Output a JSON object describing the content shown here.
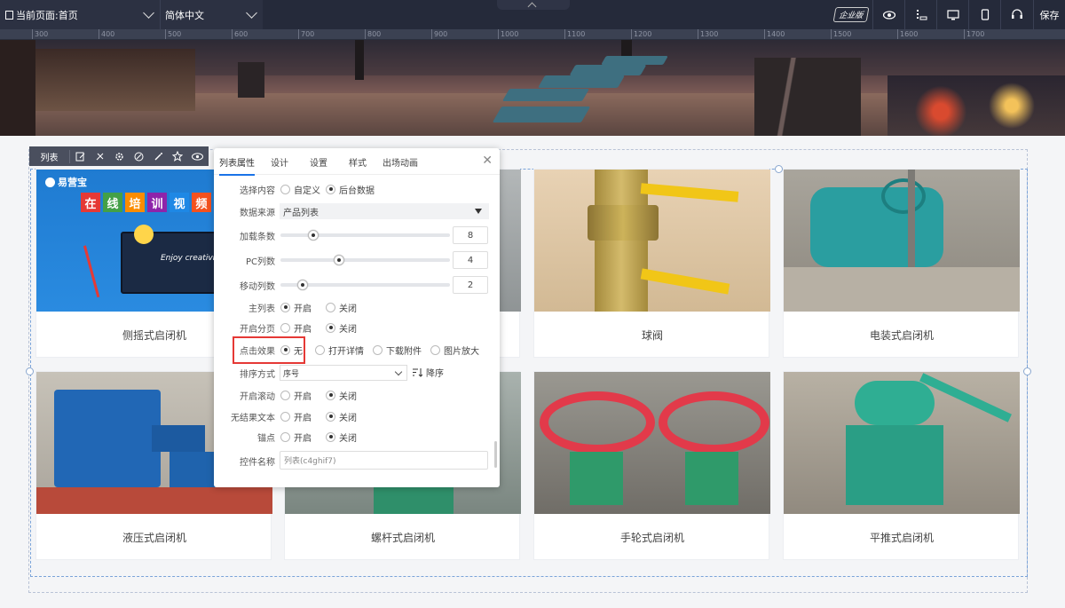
{
  "topbar": {
    "current_page": "当前页面:首页",
    "language": "简体中文",
    "edition": "企业版",
    "save": "保存"
  },
  "ruler": [
    "300",
    "400",
    "500",
    "600",
    "700",
    "800",
    "900",
    "1000",
    "1100",
    "1200",
    "1300",
    "1400",
    "1500",
    "1600",
    "1700"
  ],
  "toolbar": {
    "label": "列表"
  },
  "products": [
    {
      "name": "侧摇式启闭机"
    },
    {
      "name": ""
    },
    {
      "name": "球阀"
    },
    {
      "name": "电装式启闭机"
    },
    {
      "name": "液压式启闭机"
    },
    {
      "name": "螺杆式启闭机"
    },
    {
      "name": "手轮式启闭机"
    },
    {
      "name": "平推式启闭机"
    }
  ],
  "card1_overlay": {
    "logo": "易营宝",
    "chars": [
      "在",
      "线",
      "培",
      "训",
      "视",
      "频"
    ]
  },
  "panel": {
    "tabs": [
      "列表属性",
      "设计",
      "设置",
      "样式",
      "出场动画"
    ],
    "close": "✕",
    "content_source": {
      "label": "选择内容",
      "options": [
        "自定义",
        "后台数据"
      ],
      "selected": 1
    },
    "data_source": {
      "label": "数据来源",
      "value": "产品列表"
    },
    "load_count": {
      "label": "加载条数",
      "value": 8
    },
    "pc_columns": {
      "label": "PC列数",
      "value": 4
    },
    "mobile_columns": {
      "label": "移动列数",
      "value": 2
    },
    "main_list": {
      "label": "主列表",
      "options": [
        "开启",
        "关闭"
      ],
      "selected": 0
    },
    "pagination": {
      "label": "开启分页",
      "options": [
        "开启",
        "关闭"
      ],
      "selected": 1
    },
    "click_effect": {
      "label": "点击效果",
      "options": [
        "无",
        "打开详情",
        "下载附件",
        "图片放大"
      ],
      "selected": 0
    },
    "sort": {
      "label": "排序方式",
      "value": "序号",
      "order": "降序"
    },
    "scroll": {
      "label": "开启滚动",
      "options": [
        "开启",
        "关闭"
      ],
      "selected": 1
    },
    "no_result_text": {
      "label": "无结果文本",
      "options": [
        "开启",
        "关闭"
      ],
      "selected": 1
    },
    "anchor": {
      "label": "锚点",
      "options": [
        "开启",
        "关闭"
      ],
      "selected": 1
    },
    "control_name": {
      "label": "控件名称",
      "value": "列表(c4ghif7)"
    }
  }
}
